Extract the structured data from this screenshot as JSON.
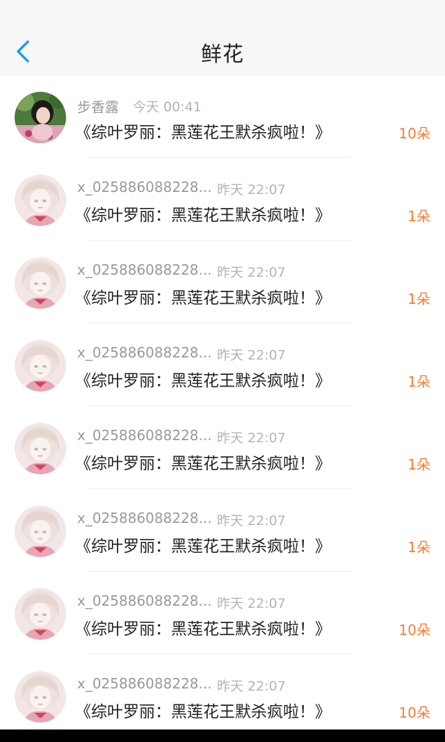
{
  "header": {
    "title": "鲜花",
    "back_icon": "chevron-left-icon"
  },
  "colors": {
    "accent": "#1e9bf0",
    "amount": "#ff7a2e",
    "name": "#999999",
    "time": "#b3b3b3"
  },
  "records": [
    {
      "name": "步香露",
      "time": "今天 00:41",
      "book": "《综叶罗丽：黑莲花王默杀疯啦！》",
      "amount": "10朵",
      "avatar": "photo-avatar"
    },
    {
      "name": "x_025886088228...",
      "time": "昨天 22:07",
      "book": "《综叶罗丽：黑莲花王默杀疯啦！》",
      "amount": "1朵",
      "avatar": "anime-avatar"
    },
    {
      "name": "x_025886088228...",
      "time": "昨天 22:07",
      "book": "《综叶罗丽：黑莲花王默杀疯啦！》",
      "amount": "1朵",
      "avatar": "anime-avatar"
    },
    {
      "name": "x_025886088228...",
      "time": "昨天 22:07",
      "book": "《综叶罗丽：黑莲花王默杀疯啦！》",
      "amount": "1朵",
      "avatar": "anime-avatar"
    },
    {
      "name": "x_025886088228...",
      "time": "昨天 22:07",
      "book": "《综叶罗丽：黑莲花王默杀疯啦！》",
      "amount": "1朵",
      "avatar": "anime-avatar"
    },
    {
      "name": "x_025886088228...",
      "time": "昨天 22:07",
      "book": "《综叶罗丽：黑莲花王默杀疯啦！》",
      "amount": "1朵",
      "avatar": "anime-avatar"
    },
    {
      "name": "x_025886088228...",
      "time": "昨天 22:07",
      "book": "《综叶罗丽：黑莲花王默杀疯啦！》",
      "amount": "10朵",
      "avatar": "anime-avatar"
    },
    {
      "name": "x_025886088228...",
      "time": "昨天 22:07",
      "book": "《综叶罗丽：黑莲花王默杀疯啦！》",
      "amount": "10朵",
      "avatar": "anime-avatar"
    }
  ]
}
